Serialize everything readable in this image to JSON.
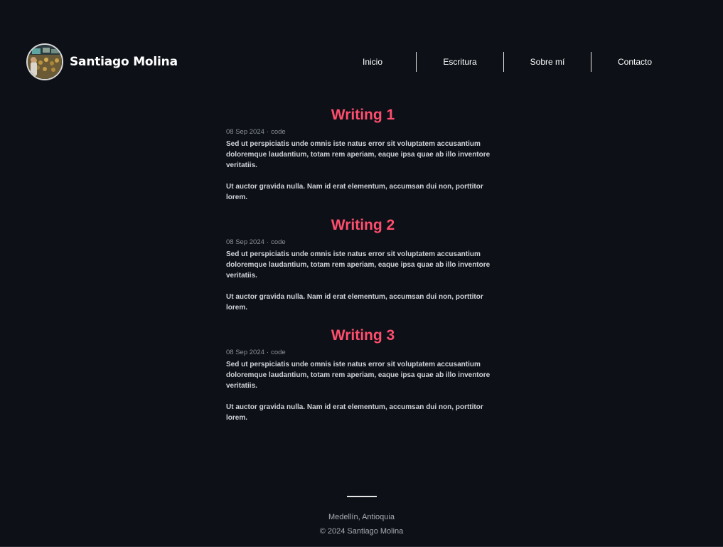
{
  "header": {
    "site_name": "Santiago Molina",
    "nav": [
      {
        "label": "Inicio"
      },
      {
        "label": "Escritura"
      },
      {
        "label": "Sobre mí"
      },
      {
        "label": "Contacto"
      }
    ]
  },
  "posts": [
    {
      "title": "Writing 1",
      "date": "08 Sep 2024",
      "tag": "code",
      "paragraph_1": "Sed ut perspiciatis unde omnis iste natus error sit voluptatem accusantium doloremque laudantium, totam rem aperiam, eaque ipsa quae ab illo inventore veritatiis.",
      "paragraph_2": "Ut auctor gravida nulla. Nam id erat elementum, accumsan dui non, porttitor lorem."
    },
    {
      "title": "Writing 2",
      "date": "08 Sep 2024",
      "tag": "code",
      "paragraph_1": "Sed ut perspiciatis unde omnis iste natus error sit voluptatem accusantium doloremque laudantium, totam rem aperiam, eaque ipsa quae ab illo inventore veritatiis.",
      "paragraph_2": "Ut auctor gravida nulla. Nam id erat elementum, accumsan dui non, porttitor lorem."
    },
    {
      "title": "Writing 3",
      "date": "08 Sep 2024",
      "tag": "code",
      "paragraph_1": "Sed ut perspiciatis unde omnis iste natus error sit voluptatem accusantium doloremque laudantium, totam rem aperiam, eaque ipsa quae ab illo inventore veritatiis.",
      "paragraph_2": "Ut auctor gravida nulla. Nam id erat elementum, accumsan dui non, porttitor lorem."
    }
  ],
  "footer": {
    "location": "Medellín, Antioquia",
    "copyright": "© 2024 Santiago Molina"
  },
  "colors": {
    "background": "#0d1117",
    "accent": "#ff4d6d",
    "text": "#ffffff",
    "muted": "#8b8f96"
  },
  "icons": {
    "avatar": "profile-photo"
  }
}
